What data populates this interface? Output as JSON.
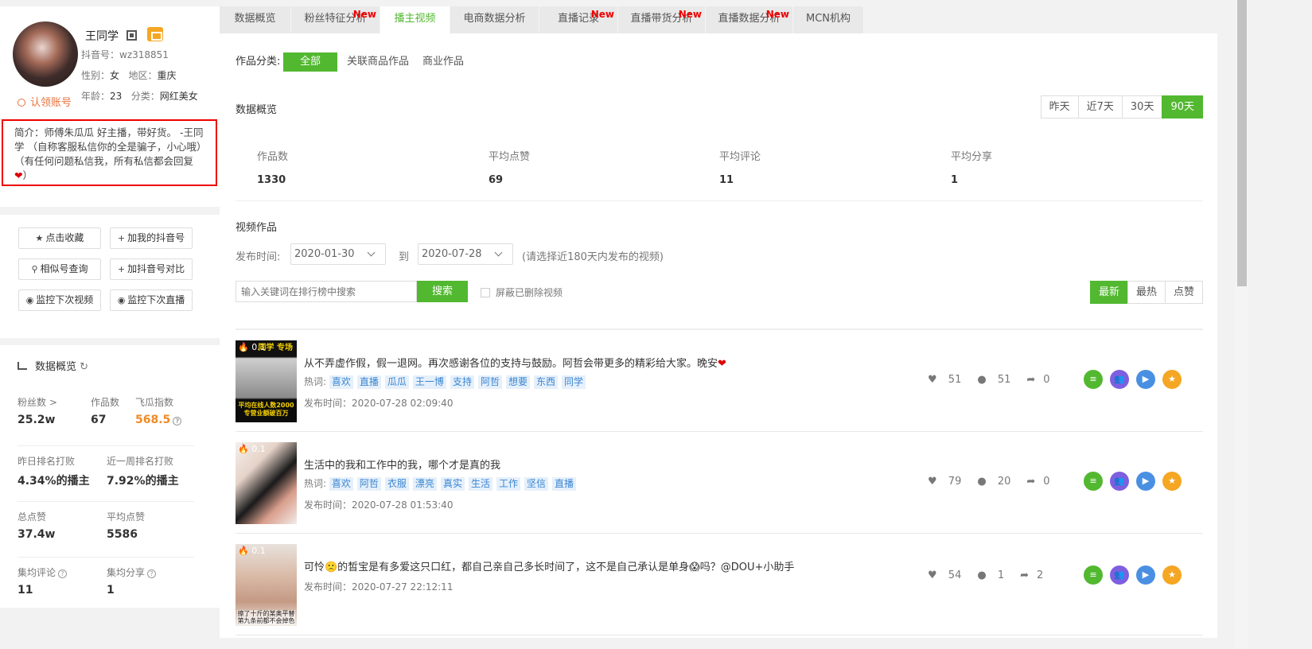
{
  "profile": {
    "name": "王同学",
    "douyin_id": "抖音号：wz318851",
    "gender_label": "性别：",
    "gender": "女",
    "region_label": "地区：",
    "region": "重庆",
    "age_label": "年龄：",
    "age": "23",
    "category_label": "分类：",
    "category": "网红美女",
    "claim": "认领账号",
    "intro": "简介：师傅朱瓜瓜 好主播，带好货。 -王同学 （自称客服私信你的全是骗子，小心哦）（有任何问题私信我，所有私信都会回复",
    "intro_end": "）"
  },
  "actions": [
    "点击收藏",
    "加我的抖音号",
    "相似号查询",
    "加抖音号对比",
    "监控下次视频",
    "监控下次直播"
  ],
  "stats": {
    "title": "数据概览",
    "fans_label": "粉丝数 >",
    "fans": "25.2w",
    "works_label": "作品数",
    "works": "67",
    "index_label": "飞瓜指数",
    "index": "568.5",
    "rank_y_label": "昨日排名打败",
    "rank_y": "4.34%的播主",
    "rank_w_label": "近一周排名打败",
    "rank_w": "7.92%的播主",
    "likes_label": "总点赞",
    "likes": "37.4w",
    "avg_likes_label": "平均点赞",
    "avg_likes": "5586",
    "avg_comment_label": "集均评论",
    "avg_comment": "11",
    "avg_share_label": "集均分享",
    "avg_share": "1"
  },
  "tabs": [
    {
      "label": "数据概览"
    },
    {
      "label": "粉丝特征分析",
      "new": "New"
    },
    {
      "label": "播主视频"
    },
    {
      "label": "电商数据分析"
    },
    {
      "label": "直播记录",
      "new": "New"
    },
    {
      "label": "直播带货分析",
      "new": "New"
    },
    {
      "label": "直播数据分析",
      "new": "New"
    },
    {
      "label": "MCN机构"
    }
  ],
  "filter": {
    "label": "作品分类:",
    "options": [
      "全部",
      "关联商品作品",
      "商业作品"
    ]
  },
  "overview": {
    "title": "数据概览",
    "ranges": [
      "昨天",
      "近7天",
      "30天",
      "90天"
    ],
    "items": [
      {
        "label": "作品数",
        "value": "1330"
      },
      {
        "label": "平均点赞",
        "value": "69"
      },
      {
        "label": "平均评论",
        "value": "11"
      },
      {
        "label": "平均分享",
        "value": "1"
      }
    ]
  },
  "videos_section": {
    "title": "视频作品",
    "date_label": "发布时间:",
    "date_from": "2020-01-30",
    "to_label": "到",
    "date_to": "2020-07-28",
    "hint": "(请选择近180天内发布的视频)",
    "search_placeholder": "输入关键词在排行榜中搜索",
    "search_btn": "搜索",
    "hide_deleted": "屏蔽已删除视频",
    "sort": [
      "最新",
      "最热",
      "点赞"
    ]
  },
  "videos": [
    {
      "score": "0.1",
      "title": "从不弄虚作假，假一退网。再次感谢各位的支持与鼓励。阿哲会带更多的精彩给大家。晚安",
      "hot_label": "热词:",
      "tags": [
        "喜欢",
        "直播",
        "瓜瓜",
        "王一博",
        "支持",
        "阿哲",
        "想要",
        "东西",
        "同学"
      ],
      "time": "发布时间：2020-07-28 02:09:40",
      "likes": "51",
      "comments": "51",
      "shares": "0",
      "thumb_text": "平均在线人数2000 专营业额破百万",
      "thumb_top": "同学 专场"
    },
    {
      "score": "0.1",
      "title": "生活中的我和工作中的我，哪个才是真的我",
      "hot_label": "热词:",
      "tags": [
        "喜欢",
        "阿哲",
        "衣服",
        "漂亮",
        "真实",
        "生活",
        "工作",
        "坚信",
        "直播"
      ],
      "time": "发布时间：2020-07-28 01:53:40",
      "likes": "79",
      "comments": "20",
      "shares": "0"
    },
    {
      "score": "0.1",
      "title": "可怜🙁的皙宝是有多爱这只口红，都自己亲自己多长时间了，这不是自己承认是单身😱吗？@DOU+小助手",
      "time": "发布时间：2020-07-27 22:12:11",
      "likes": "54",
      "comments": "1",
      "shares": "2",
      "thumb_text": "擦了十斤的某奥平替 第九条前都不会掉色"
    }
  ],
  "colors": {
    "accent": "#52b830",
    "orange": "#f08a24",
    "new": "#e00000"
  }
}
